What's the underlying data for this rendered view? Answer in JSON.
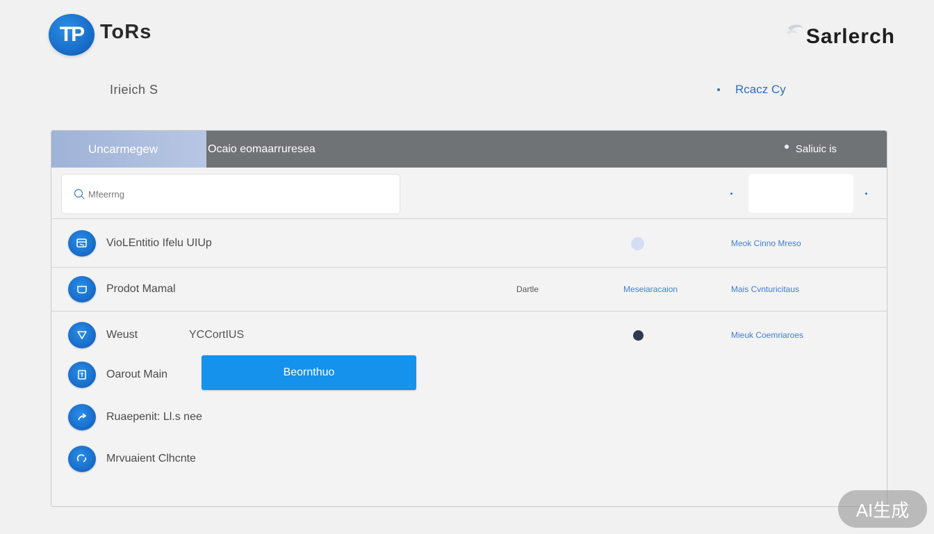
{
  "header": {
    "logo_badge": "TP",
    "logo_text": "ToRs",
    "brand": "Sarlerch",
    "subtitle_left": "Irieich S",
    "subtitle_right": "Rcacz Cy"
  },
  "panel": {
    "tab_label": "Uncarmegew",
    "title": "Ocaio eomaarruresea",
    "status": "Saliuic is",
    "search_placeholder": "Mfeerrng"
  },
  "rows": [
    {
      "label": "VioLEntitio Ifelu UIUp",
      "icon": "browser-window-icon",
      "link": "Meok Cinno Mreso"
    },
    {
      "label": "Prodot Mamal",
      "icon": "chat-bubble-icon",
      "col1": "Dartle",
      "col2": "Meseiaracaion",
      "link": "Mais Cvnturicitaus"
    },
    {
      "label": "Weust",
      "tag": "YCCortIUS",
      "icon": "shield-icon",
      "link": "Mieuk Coemriaroes"
    },
    {
      "label": "Oarout Main",
      "icon": "document-icon",
      "button": "Beornthuo"
    },
    {
      "label": "Ruaepenit: Ll.s nee",
      "icon": "share-arrow-icon"
    },
    {
      "label": "Mrvuaient Clhcnte",
      "icon": "refresh-icon"
    }
  ],
  "watermark": "AI生成",
  "colors": {
    "accent": "#1592ec",
    "header_bar": "#6f7376",
    "link": "#3f7fd0",
    "background": "#f1f1f1"
  }
}
